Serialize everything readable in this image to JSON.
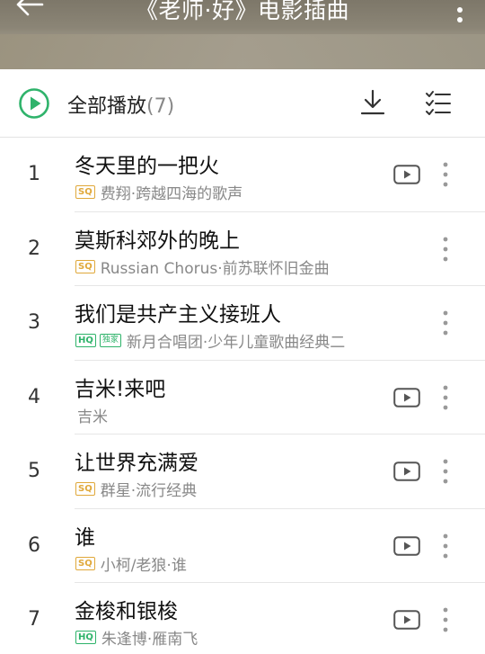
{
  "header": {
    "title": "《老师·好》电影插曲",
    "back_icon": "arrow-left-icon",
    "more_icon": "more-vertical-icon"
  },
  "toolbar": {
    "play_all_label": "全部播放",
    "play_all_count": "(7)",
    "accent_color": "#2fb36b",
    "download_icon": "download-icon",
    "multiselect_icon": "list-select-icon"
  },
  "songs": [
    {
      "index": "1",
      "title": "冬天里的一把火",
      "badges": [
        "SQ"
      ],
      "subtitle": "费翔·跨越四海的歌声",
      "has_mv": true
    },
    {
      "index": "2",
      "title": "莫斯科郊外的晚上",
      "badges": [
        "SQ"
      ],
      "subtitle": "Russian Chorus·前苏联怀旧金曲",
      "has_mv": false
    },
    {
      "index": "3",
      "title": "我们是共产主义接班人",
      "badges": [
        "HQ",
        "独家"
      ],
      "subtitle": "新月合唱团·少年儿童歌曲经典二",
      "has_mv": false
    },
    {
      "index": "4",
      "title": "吉米!来吧",
      "badges": [],
      "subtitle": "吉米",
      "has_mv": true
    },
    {
      "index": "5",
      "title": "让世界充满爱",
      "badges": [
        "SQ"
      ],
      "subtitle": "群星·流行经典",
      "has_mv": true
    },
    {
      "index": "6",
      "title": "谁",
      "badges": [
        "SQ"
      ],
      "subtitle": "小柯/老狼·谁",
      "has_mv": true
    },
    {
      "index": "7",
      "title": "金梭和银梭",
      "badges": [
        "HQ"
      ],
      "subtitle": "朱逢博·雁南飞",
      "has_mv": true
    }
  ]
}
